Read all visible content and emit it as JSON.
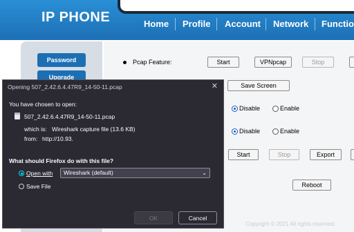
{
  "header": {
    "brand": "IP PHONE",
    "nav": [
      "Home",
      "Profile",
      "Account",
      "Network",
      "Function"
    ]
  },
  "sidebar": {
    "items": [
      "Password",
      "Upgrade"
    ]
  },
  "main": {
    "pcap_label": "Pcap Feature:",
    "pcap_buttons": [
      "Start",
      "VPNpcap",
      "Stop"
    ],
    "save_screen": "Save Screen",
    "row1": {
      "disable": "Disable",
      "enable": "Enable",
      "selected": "Disable"
    },
    "row2": {
      "disable": "Disable",
      "enable": "Enable",
      "selected": "Disable"
    },
    "log_buttons": [
      "Start",
      "Stop",
      "Export"
    ],
    "reboot": "Reboot",
    "copyright": "Copyright © 2021 All rights reserved."
  },
  "dialog": {
    "title": "Opening 507_2.42.6.4.47R9_14-50-11.pcap",
    "close": "✕",
    "intro": "You have chosen to open:",
    "filename": "507_2.42.6.4.47R9_14-50-11.pcap",
    "which_is_label": "which is:",
    "which_is_value": "Wireshark capture file (13.6 KB)",
    "from_label": "from:",
    "from_value": "http://10.93.",
    "question": "What should Firefox do with this file?",
    "open_with_label": "Open with",
    "open_with_value": "Wireshark (default)",
    "save_file_label": "Save File",
    "selected_action": "Open with",
    "ok": "OK",
    "cancel": "Cancel"
  }
}
